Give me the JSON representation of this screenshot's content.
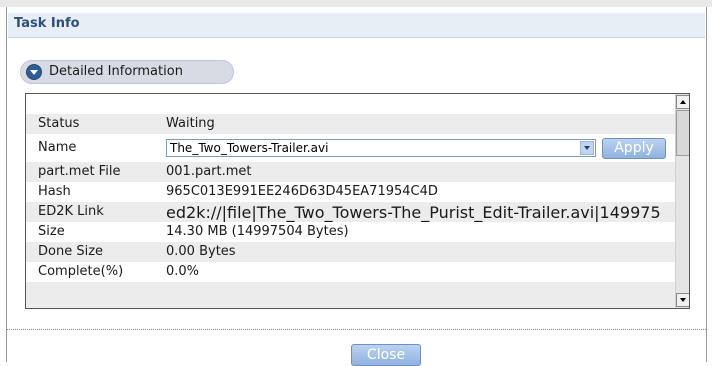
{
  "window": {
    "title": "Task Info"
  },
  "section": {
    "label": "Detailed Information",
    "icon": "collapse-arrow-icon"
  },
  "fields": {
    "status": {
      "label": "Status",
      "value": "Waiting"
    },
    "name": {
      "label": "Name",
      "value": "The_Two_Towers-Trailer.avi",
      "button": "Apply"
    },
    "partmet": {
      "label": "part.met File",
      "value": "001.part.met"
    },
    "hash": {
      "label": "Hash",
      "value": "965C013E991EE246D63D45EA71954C4D"
    },
    "ed2k": {
      "label": "ED2K Link",
      "value": "ed2k://|file|The_Two_Towers-The_Purist_Edit-Trailer.avi|149975"
    },
    "size": {
      "label": "Size",
      "value": "14.30 MB (14997504 Bytes)"
    },
    "donesize": {
      "label": "Done Size",
      "value": "0.00 Bytes"
    },
    "complete": {
      "label": "Complete(%)",
      "value": "0.0%"
    }
  },
  "footer": {
    "close_label": "Close"
  }
}
